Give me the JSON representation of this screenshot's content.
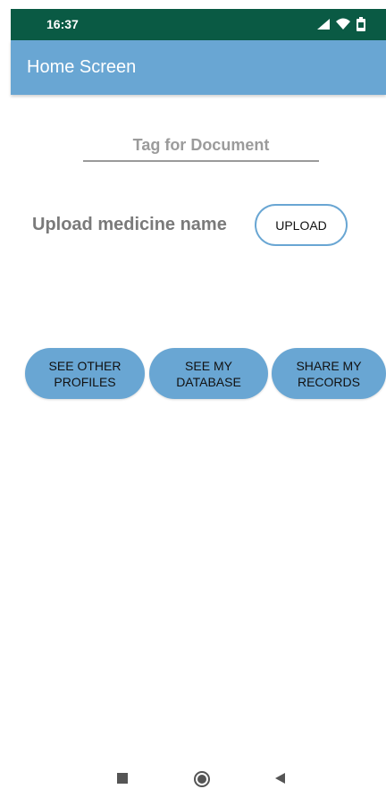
{
  "status_bar": {
    "time": "16:37",
    "background_color": "#0a5a44",
    "icons": [
      "signal-icon",
      "wifi-icon",
      "battery-icon"
    ]
  },
  "app_bar": {
    "title": "Home Screen",
    "background_color": "#69a6d3"
  },
  "tag_field": {
    "placeholder": "Tag for Document"
  },
  "upload_section": {
    "label": "Upload medicine name",
    "button_label": "UPLOAD"
  },
  "action_buttons": [
    {
      "label": "SEE OTHER\nPROFILES"
    },
    {
      "label": "SEE MY\nDATABASE"
    },
    {
      "label": "SHARE MY\nRECORDS"
    }
  ],
  "nav_bar": {
    "icons": [
      "recents-square-icon",
      "home-circle-icon",
      "back-triangle-icon"
    ]
  }
}
